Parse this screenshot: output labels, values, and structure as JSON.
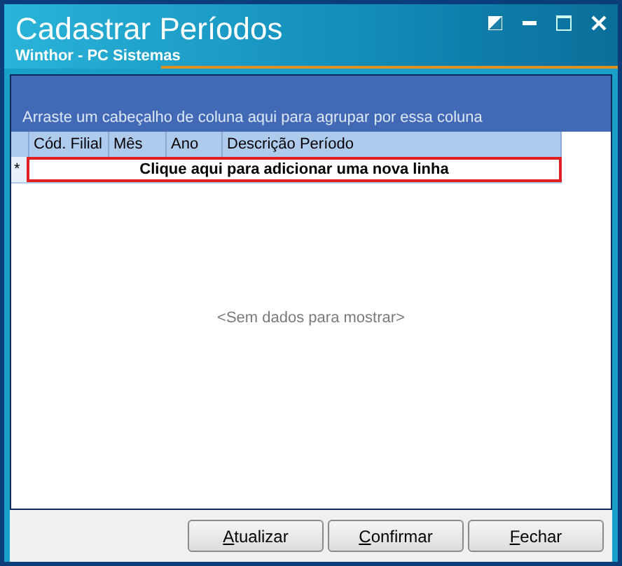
{
  "window": {
    "title": "Cadastrar Períodos",
    "subtitle": "Winthor - PC Sistemas"
  },
  "group_panel": {
    "hint": "Arraste um cabeçalho de coluna aqui para agrupar por essa coluna"
  },
  "table": {
    "columns": [
      "Cód. Filial",
      "Mês",
      "Ano",
      "Descrição Período"
    ],
    "new_row": {
      "marker": "*",
      "text": "Clique aqui para adicionar uma nova linha"
    },
    "empty_text": "<Sem dados para mostrar>"
  },
  "buttons": [
    "Atualizar",
    "Confirmar",
    "Fechar"
  ]
}
